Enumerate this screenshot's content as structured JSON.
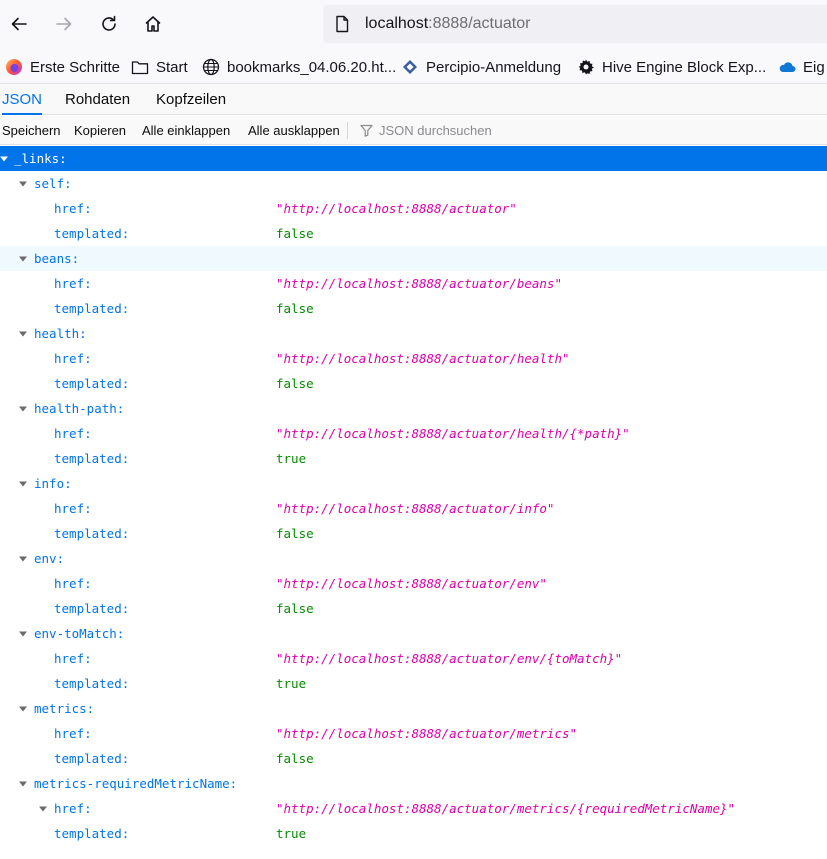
{
  "url": {
    "host": "localhost",
    "rest": ":8888/actuator"
  },
  "nav": {
    "back": "back-arrow-icon",
    "forward": "forward-arrow-icon",
    "reload": "reload-icon",
    "home": "home-icon"
  },
  "bookmarks": [
    {
      "label": "Erste Schritte",
      "icon": "firefox-icon"
    },
    {
      "label": "Start",
      "icon": "folder-icon"
    },
    {
      "label": "bookmarks_04.06.20.ht...",
      "icon": "globe-icon"
    },
    {
      "label": "Percipio-Anmeldung",
      "icon": "percipio-icon"
    },
    {
      "label": "Hive Engine Block Exp...",
      "icon": "gear-icon"
    },
    {
      "label": "Eig",
      "icon": "cloud-icon"
    }
  ],
  "tabs": [
    {
      "label": "JSON",
      "active": true
    },
    {
      "label": "Rohdaten",
      "active": false
    },
    {
      "label": "Kopfzeilen",
      "active": false
    }
  ],
  "toolbar": {
    "save": "Speichern",
    "copy": "Kopieren",
    "collapse_all": "Alle einklappen",
    "expand_all": "Alle ausklappen",
    "filter_placeholder": "JSON durchsuchen"
  },
  "colors": {
    "accent": "#0074e8",
    "string": "#dd00a9",
    "boolean": "#058b00"
  },
  "tree": {
    "root_key": "_links:",
    "entries": [
      {
        "key": "self:",
        "href": "\"http://localhost:8888/actuator\"",
        "templated": "false"
      },
      {
        "key": "beans:",
        "href": "\"http://localhost:8888/actuator/beans\"",
        "templated": "false"
      },
      {
        "key": "health:",
        "href": "\"http://localhost:8888/actuator/health\"",
        "templated": "false"
      },
      {
        "key": "health-path:",
        "href": "\"http://localhost:8888/actuator/health/{*path}\"",
        "templated": "true"
      },
      {
        "key": "info:",
        "href": "\"http://localhost:8888/actuator/info\"",
        "templated": "false"
      },
      {
        "key": "env:",
        "href": "\"http://localhost:8888/actuator/env\"",
        "templated": "false"
      },
      {
        "key": "env-toMatch:",
        "href": "\"http://localhost:8888/actuator/env/{toMatch}\"",
        "templated": "true"
      },
      {
        "key": "metrics:",
        "href": "\"http://localhost:8888/actuator/metrics\"",
        "templated": "false"
      },
      {
        "key": "metrics-requiredMetricName:",
        "href": "\"http://localhost:8888/actuator/metrics/{requiredMetricName}\"",
        "templated": "true"
      }
    ],
    "href_key": "href:",
    "templated_key": "templated:"
  }
}
